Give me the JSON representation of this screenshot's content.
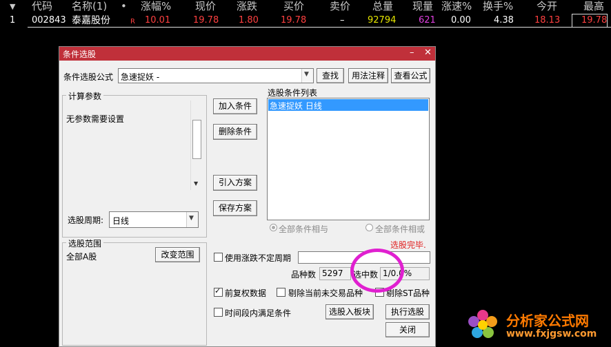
{
  "ticker": {
    "headers": [
      "代码",
      "名称(1)",
      "•",
      "涨幅%",
      "现价",
      "涨跌",
      "买价",
      "卖价",
      "总量",
      "现量",
      "涨速%",
      "换手%",
      "今开",
      "最高"
    ],
    "row": {
      "index": "1",
      "code": "002843",
      "name": "泰嘉股份",
      "flag": "R",
      "change_pct": "10.01",
      "price": "19.78",
      "change": "1.80",
      "bid": "19.78",
      "ask": "–",
      "volume": "92794",
      "cur_volume": "621",
      "speed": "0.00",
      "turnover": "4.38",
      "open": "18.13",
      "high": "19.78"
    }
  },
  "dialog": {
    "title": "条件选股",
    "formula_label": "条件选股公式",
    "formula_value": "急速捉妖  -",
    "find_button": "查找",
    "usage_button": "用法注释",
    "view_formula_button": "查看公式",
    "params_group": "计算参数",
    "params_text": "无参数需要设置",
    "period_label": "选股周期:",
    "period_value": "日线",
    "add_condition": "加入条件",
    "delete_condition": "删除条件",
    "import_plan": "引入方案",
    "save_plan": "保存方案",
    "cond_list_label": "选股条件列表",
    "cond_list_items": [
      "急速捉妖  日线"
    ],
    "radio_and": "全部条件相与",
    "radio_or": "全部条件相或",
    "status": "选股完毕.",
    "range_group": "选股范围",
    "range_value": "全部A股",
    "change_range": "改变范围",
    "use_uncertain": "使用涨跌不定周期",
    "variety_label": "品种数",
    "variety_value": "5297",
    "selected_label": "选中数",
    "selected_value": "1/0.0%",
    "adjust_label": "前复权数据",
    "exclude_suspended": "剔除当前未交易品种",
    "exclude_st": "剔除ST品种",
    "time_range_label": "时间段内满足条件",
    "select_to_block": "选股入板块",
    "run_select": "执行选股",
    "close": "关闭"
  },
  "watermark": {
    "text": "分析家公式网",
    "url": "www.fxjgsw.com"
  },
  "colors": {
    "title_red": "#c0303a",
    "price_red": "#ff4040",
    "highlight_blue": "#3399ff",
    "annot_magenta": "#e020d0"
  }
}
